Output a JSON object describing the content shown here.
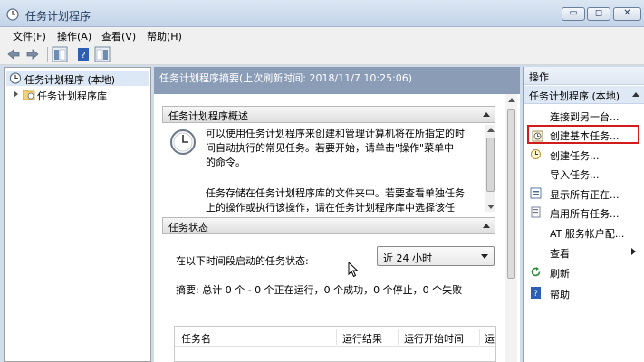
{
  "window": {
    "title": "任务计划程序",
    "buttons": {
      "minimize": "▭",
      "maximize": "◻",
      "close": "✕"
    }
  },
  "menu": [
    "文件(F)",
    "操作(A)",
    "查看(V)",
    "帮助(H)"
  ],
  "tree": [
    {
      "label": "任务计划程序 (本地)",
      "icon": "clock-icon",
      "selected": true
    },
    {
      "label": "任务计划程序库",
      "icon": "folder-clock-icon",
      "selected": false
    }
  ],
  "center": {
    "header": "任务计划程序摘要(上次刷新时间: 2018/11/7 10:25:06)",
    "overview": {
      "title": "任务计划程序概述",
      "para1": [
        "可以使用任务计划程序来创建和管理计算机将在所指定的时",
        "间自动执行的常见任务。若要开始，请单击\"操作\"菜单中",
        "的命令。"
      ],
      "para2": [
        "任务存储在任务计划程序库的文件夹中。若要查看单独任务",
        "上的操作或执行该操作，请在任务计划程序库中选择该任"
      ]
    },
    "status": {
      "title": "任务状态",
      "label": "在以下时间段启动的任务状态:",
      "dropdown": "近 24 小时",
      "summary": "摘要: 总计 0 个 - 0 个正在运行，0 个成功，0 个停止，0 个失败",
      "columns": [
        "任务名",
        "运行结果",
        "运行开始时间",
        "运"
      ]
    }
  },
  "actions": {
    "header": "操作",
    "group": "任务计划程序 (本地)",
    "items": [
      {
        "label": "连接到另一台...",
        "icon": ""
      },
      {
        "label": "创建基本任务...",
        "icon": "create-basic-task-icon",
        "highlighted": true
      },
      {
        "label": "创建任务...",
        "icon": "create-task-icon"
      },
      {
        "label": "导入任务...",
        "icon": ""
      },
      {
        "label": "显示所有正在...",
        "icon": "running-tasks-icon"
      },
      {
        "label": "启用所有任务...",
        "icon": "enable-history-icon"
      },
      {
        "label": "AT 服务帐户配...",
        "icon": ""
      },
      {
        "label": "查看",
        "icon": "",
        "submenu": true
      },
      {
        "label": "刷新",
        "icon": "refresh-icon"
      },
      {
        "label": "帮助",
        "icon": "help-icon"
      }
    ]
  },
  "colors": {
    "highlight": "#d21b1b",
    "header_bg": "#8b9cb7",
    "selection": "#dde8f6"
  }
}
